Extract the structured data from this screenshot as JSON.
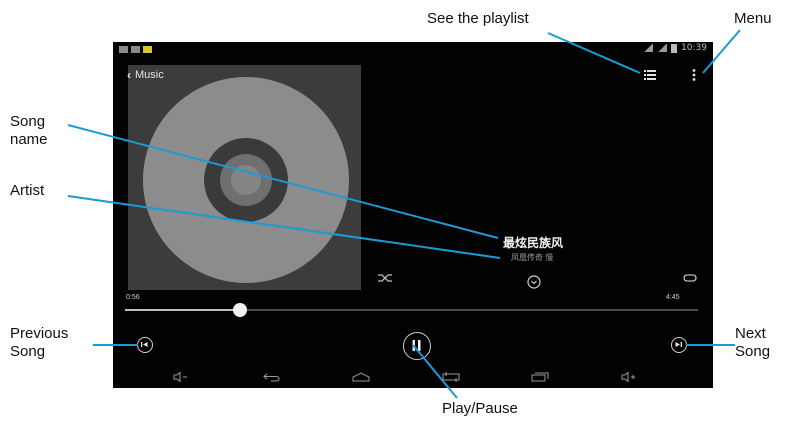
{
  "annotations": {
    "see_playlist": "See the playlist",
    "menu": "Menu",
    "song_name": "Song\nname",
    "artist": "Artist",
    "previous_song": "Previous\nSong",
    "next_song": "Next\nSong",
    "play_pause": "Play/Pause"
  },
  "device": {
    "status_time": "10:39",
    "top_title": "Music",
    "track": {
      "title": "最炫民族风",
      "artist": "凤凰传奇 慢"
    },
    "elapsed": "0:56",
    "total": "4:45",
    "progress_fraction": 0.2
  },
  "colors": {
    "callout_line": "#1a9ad6",
    "screen_bg": "#020202",
    "album_bg": "#3c3c3c",
    "disc": "#8c8c8c"
  },
  "icons": {
    "playlist": "list-icon",
    "menu": "overflow-menu-icon",
    "back": "chevron-left-icon",
    "shuffle": "shuffle-icon",
    "repeat": "repeat-icon",
    "previous": "skip-previous-icon",
    "next": "skip-next-icon",
    "play_pause": "pause-icon"
  }
}
